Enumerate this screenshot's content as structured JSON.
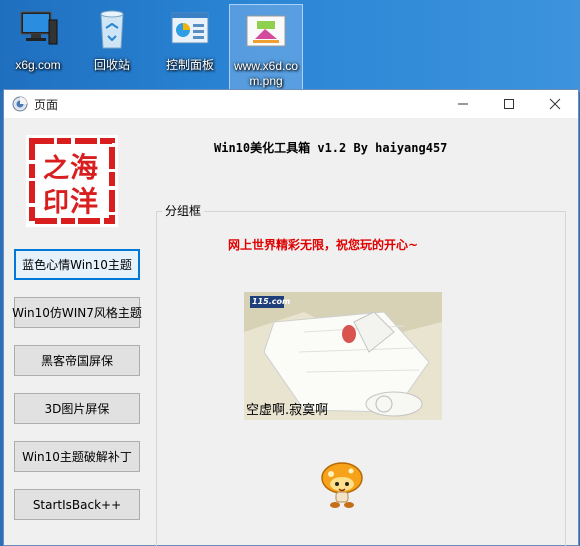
{
  "desktop": {
    "icons": [
      {
        "label": "x6g.com",
        "icon": "computer-icon"
      },
      {
        "label": "回收站",
        "icon": "recycle-bin-icon"
      },
      {
        "label": "控制面板",
        "icon": "control-panel-icon"
      },
      {
        "label": "www.x6d.com.png",
        "icon": "image-file-icon"
      }
    ]
  },
  "window": {
    "title": "页面",
    "app_title": "Win10美化工具箱 v1.2 By haiyang457",
    "seal_text": [
      "海",
      "之",
      "洋",
      "印"
    ],
    "buttons": [
      "蓝色心情Win10主题",
      "Win10仿WIN7风格主题",
      "黑客帝国屏保",
      "3D图片屏保",
      "Win10主题破解补丁",
      "StartIsBack++"
    ],
    "group_label": "分组框",
    "slogan": "网上世界精彩无限，祝您玩的开心~",
    "image_caption": "空虚啊.寂寞啊",
    "image_watermark": "115.com"
  },
  "colors": {
    "accent": "#0078d7",
    "slogan": "#e00000",
    "seal": "#d81e1e"
  }
}
